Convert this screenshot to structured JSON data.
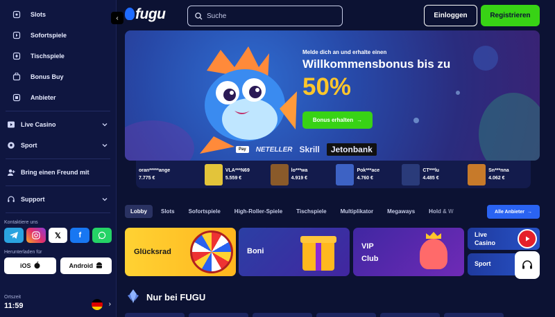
{
  "sidebar": {
    "sub_items": [
      {
        "label": "Slots",
        "icon": "slots-icon"
      },
      {
        "label": "Sofortspiele",
        "icon": "instant-games-icon"
      },
      {
        "label": "Tischspiele",
        "icon": "table-games-icon"
      },
      {
        "label": "Bonus Buy",
        "icon": "bonus-buy-icon"
      },
      {
        "label": "Anbieter",
        "icon": "providers-icon"
      }
    ],
    "main_items": [
      {
        "label": "Live Casino",
        "icon": "live-casino-icon"
      },
      {
        "label": "Sport",
        "icon": "sport-icon"
      }
    ],
    "refer": "Bring einen Freund mit",
    "support": "Support",
    "contact_title": "Kontaktiere uns",
    "download_title": "Herunterladen für",
    "ios": "iOS",
    "android": "Android",
    "time_label": "Ortszeit",
    "time_value": "11:59"
  },
  "header": {
    "logo": "fugu",
    "search_placeholder": "Suche",
    "login": "Einloggen",
    "register": "Registrieren"
  },
  "banner": {
    "pre": "Melde dich an und erhalte einen",
    "title": "Willkommensbonus bis zu",
    "percent": "50%",
    "button": "Bonus erhalten",
    "payments": [
      "Pay",
      "NETELLER",
      "Skrill",
      "Jetonbank"
    ]
  },
  "winners": [
    {
      "name": "oran*****ange",
      "amount": "7.775 €",
      "color": "#f2d14a"
    },
    {
      "name": "VLA***N69",
      "amount": "5.559 €",
      "color": "#e3c43a"
    },
    {
      "name": "lo***wa",
      "amount": "4.919 €",
      "color": "#8a5a2a"
    },
    {
      "name": "Pok***ace",
      "amount": "4.760 €",
      "color": "#3d62c4"
    },
    {
      "name": "CT***lu",
      "amount": "4.485 €",
      "color": "#2a3b7a"
    },
    {
      "name": "Sn***nna",
      "amount": "4.062 €",
      "color": "#c77a2a"
    }
  ],
  "tabs": [
    "Lobby",
    "Slots",
    "Sofortspiele",
    "High-Roller-Spiele",
    "Tischspiele",
    "Multiplikator",
    "Megaways",
    "Hold & W"
  ],
  "all_providers": "Alle Anbieter",
  "cards": {
    "wheel": "Glücksrad",
    "boni": "Boni",
    "vip": "VIP Club",
    "live": "Live Casino",
    "sport": "Sport"
  },
  "section_title": "Nur bei FUGU",
  "colors": {
    "accent_green": "#38d315",
    "accent_blue": "#2a63f2",
    "gold": "#ffc62b",
    "bg": "#0c1233"
  }
}
